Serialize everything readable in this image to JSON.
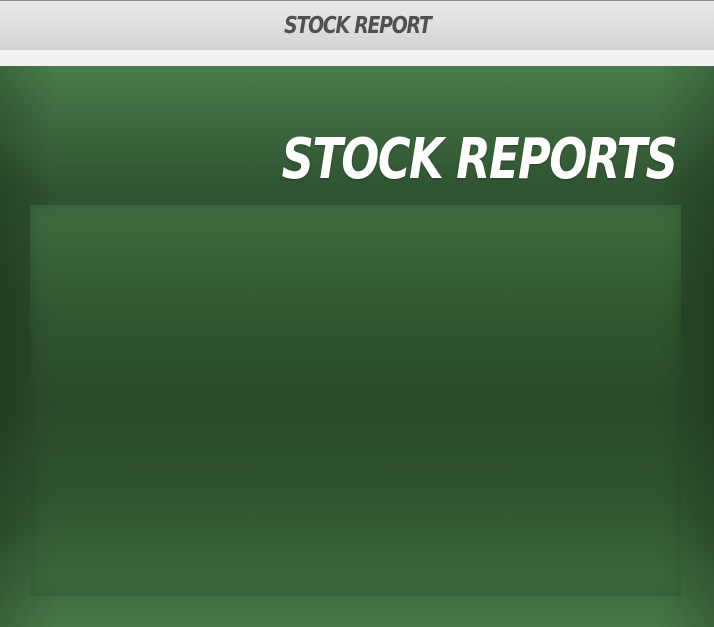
{
  "window": {
    "title": "STOCK REPORT"
  },
  "main": {
    "heading": "STOCK REPORTS"
  },
  "colors": {
    "titlebar_text": "#505050",
    "background_green": "#2a4a2b",
    "heading_text": "#ffffff"
  }
}
